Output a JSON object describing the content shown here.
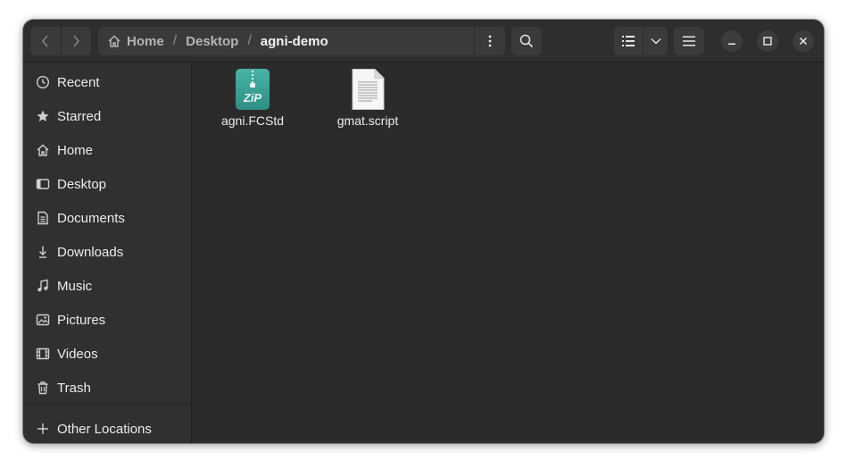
{
  "window": {
    "background": "#2b2b2b",
    "sidebar_background": "#303030",
    "accent": "#3fa69a"
  },
  "header": {
    "back_icon": "chevron-left-icon",
    "forward_icon": "chevron-right-icon",
    "path": {
      "home_icon": "home-icon",
      "segments": [
        "Home",
        "Desktop",
        "agni-demo"
      ],
      "separator": "/"
    },
    "path_menu_icon": "vertical-dots-icon",
    "search_icon": "search-icon",
    "view_icon": "list-view-icon",
    "view_dropdown_icon": "chevron-down-icon",
    "main_menu_icon": "hamburger-icon",
    "window_controls": [
      "minimize-icon",
      "maximize-icon",
      "close-icon"
    ]
  },
  "sidebar": {
    "items": [
      {
        "label": "Recent",
        "icon": "clock-icon"
      },
      {
        "label": "Starred",
        "icon": "star-icon"
      },
      {
        "label": "Home",
        "icon": "home-icon"
      },
      {
        "label": "Desktop",
        "icon": "desktop-icon"
      },
      {
        "label": "Documents",
        "icon": "document-icon"
      },
      {
        "label": "Downloads",
        "icon": "download-icon"
      },
      {
        "label": "Music",
        "icon": "music-icon"
      },
      {
        "label": "Pictures",
        "icon": "picture-icon"
      },
      {
        "label": "Videos",
        "icon": "film-icon"
      },
      {
        "label": "Trash",
        "icon": "trash-icon"
      }
    ],
    "other_locations": {
      "label": "Other Locations",
      "icon": "plus-icon"
    }
  },
  "files": [
    {
      "name": "agni.FCStd",
      "icon": "zip-archive-icon",
      "badge_text": "ZiP"
    },
    {
      "name": "gmat.script",
      "icon": "text-file-icon"
    }
  ]
}
